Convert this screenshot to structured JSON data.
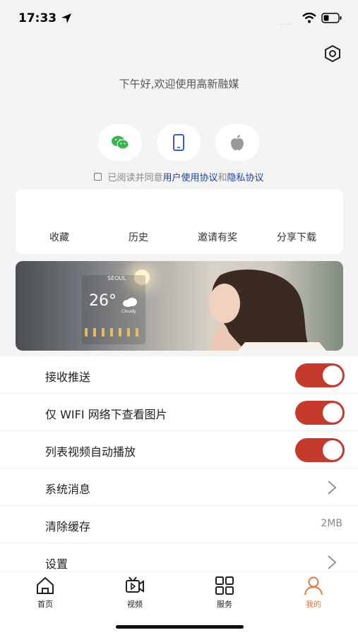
{
  "status_bar": {
    "time": "17:33",
    "signal": "....",
    "icons": [
      "location-arrow-icon",
      "wifi-icon",
      "battery-icon"
    ]
  },
  "header": {
    "greeting": "下午好,欢迎使用高新融媒",
    "settings_icon": "hexagon-settings-icon"
  },
  "login": {
    "methods": [
      {
        "name": "wechat",
        "icon": "wechat-icon",
        "color": "#37b44a"
      },
      {
        "name": "phone",
        "icon": "phone-icon",
        "color": "#3a5bd6"
      },
      {
        "name": "apple",
        "icon": "apple-icon",
        "color": "#999999"
      }
    ]
  },
  "agreement": {
    "prefix": "已阅读并同意",
    "user_agreement": "用户使用协议",
    "and": "和",
    "privacy_policy": "隐私协议"
  },
  "quick_actions": {
    "items": [
      {
        "label": "收藏"
      },
      {
        "label": "历史"
      },
      {
        "label": "邀请有奖"
      },
      {
        "label": "分享下载"
      }
    ]
  },
  "banner": {
    "city": "SEOUL",
    "temp": "26°",
    "sub": "Cloudy"
  },
  "settings": {
    "push_label": "接收推送",
    "wifi_images_label": "仅 WIFI 网络下查看图片",
    "autoplay_label": "列表视频自动播放",
    "system_msg_label": "系统消息",
    "clear_cache_label": "清除缓存",
    "cache_size": "2MB",
    "settings_label": "设置",
    "toggles": {
      "push": true,
      "wifi_images": true,
      "autoplay": true
    }
  },
  "tabs": [
    {
      "label": "首页",
      "icon": "home-icon",
      "active": false
    },
    {
      "label": "视频",
      "icon": "video-icon",
      "active": false
    },
    {
      "label": "服务",
      "icon": "grid-icon",
      "active": false
    },
    {
      "label": "我的",
      "icon": "user-icon",
      "active": true
    }
  ],
  "colors": {
    "accent": "#e0773b",
    "toggle_on": "#c53a2a",
    "link": "#1e3fa8"
  }
}
